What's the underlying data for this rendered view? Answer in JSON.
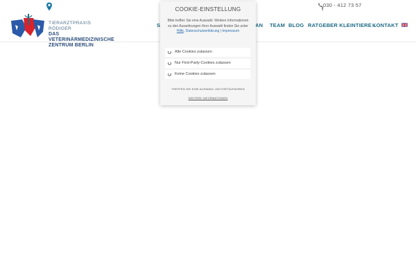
{
  "topbar": {
    "phone": "030 - 412 73 57",
    "facebook_icon": "facebook-icon",
    "location_icon": "map-pin-icon"
  },
  "logo": {
    "line1": "TIERARZTPRAXIS RÖDIGER",
    "line2": "DAS VETERINÄRMEDIZINISCHE",
    "line3": "ZENTRUM BERLIN",
    "colors": {
      "red": "#d8232a",
      "blue": "#2b5aa8"
    }
  },
  "nav": {
    "partial_left": "S",
    "partial_right": "AN",
    "team": "TEAM",
    "blog": "BLOG",
    "ratgeber": "RATGEBER KLEINTIERE",
    "kontakt": "KONTAKT",
    "flag_icon": "uk-flag-icon",
    "color": "#1f6b85"
  },
  "cookie": {
    "title": "COOKIE-EINSTELLUNG",
    "desc_1": "Bitte treffen Sie eine Auswahl. Weitere Informationen zu den Auswirkungen Ihrer Auswahl finden Sie unter ",
    "link_hilfe": "Hilfe",
    "link_datenschutz": "Datenschutzerklärung",
    "sep": " | ",
    "link_impressum": "Impressum",
    "options": [
      "Alle Cookies zulassen",
      "Nur First-Party-Cookies zulassen",
      "Keine Cookies zulassen"
    ],
    "note": "TREFFEN SIE EINE AUSWAHL UM FORTZUFAHREN",
    "more": "WEITERE INFORMATIONEN"
  }
}
